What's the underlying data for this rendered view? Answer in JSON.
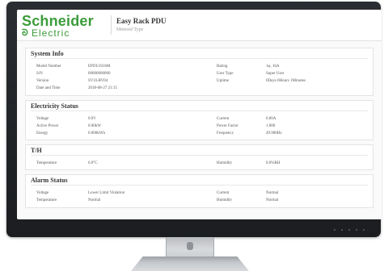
{
  "header": {
    "logo_top": "Schneider",
    "logo_bottom": "Electric",
    "title": "Easy Rack PDU",
    "subtitle": "Metered Type"
  },
  "sections": {
    "system_info": {
      "title": "System Info",
      "rows": [
        {
          "l1": "Model Number",
          "v1": "EPDU1016M",
          "l2": "Rating",
          "v2": "1φ, 16A"
        },
        {
          "l1": "S/N",
          "v1": "00000000000",
          "l2": "User Type",
          "v2": "Super User"
        },
        {
          "l1": "Version",
          "v1": "SV16.RV04",
          "l2": "Uptime",
          "v2": "0Days 0Hours 1Minutes"
        },
        {
          "l1": "Date and Time",
          "v1": "2018-08-27 21:15",
          "l2": "",
          "v2": ""
        }
      ]
    },
    "electricity_status": {
      "title": "Electricity Status",
      "rows": [
        {
          "l1": "Voltage",
          "v1": "0.0V",
          "l2": "Current",
          "v2": "0.00A"
        },
        {
          "l1": "Active Power",
          "v1": "0.00kW",
          "l2": "Power Factor",
          "v2": "1.000"
        },
        {
          "l1": "Energy",
          "v1": "0.000kWh",
          "l2": "Frequency",
          "v2": "49.900Hz"
        }
      ]
    },
    "th": {
      "title": "T/H",
      "rows": [
        {
          "l1": "Temperature",
          "v1": "0.0°C",
          "l2": "Humidity",
          "v2": "0.0%RH"
        }
      ]
    },
    "alarm_status": {
      "title": "Alarm Status",
      "rows": [
        {
          "l1": "Voltage",
          "v1": "Lower Limit Violation",
          "l2": "Current",
          "v2": "Normal"
        },
        {
          "l1": "Temperature",
          "v1": "Normal",
          "l2": "Humidity",
          "v2": "Normal"
        }
      ]
    }
  },
  "colors": {
    "brand_green": "#3b9c3a",
    "bezel": "#202326"
  }
}
